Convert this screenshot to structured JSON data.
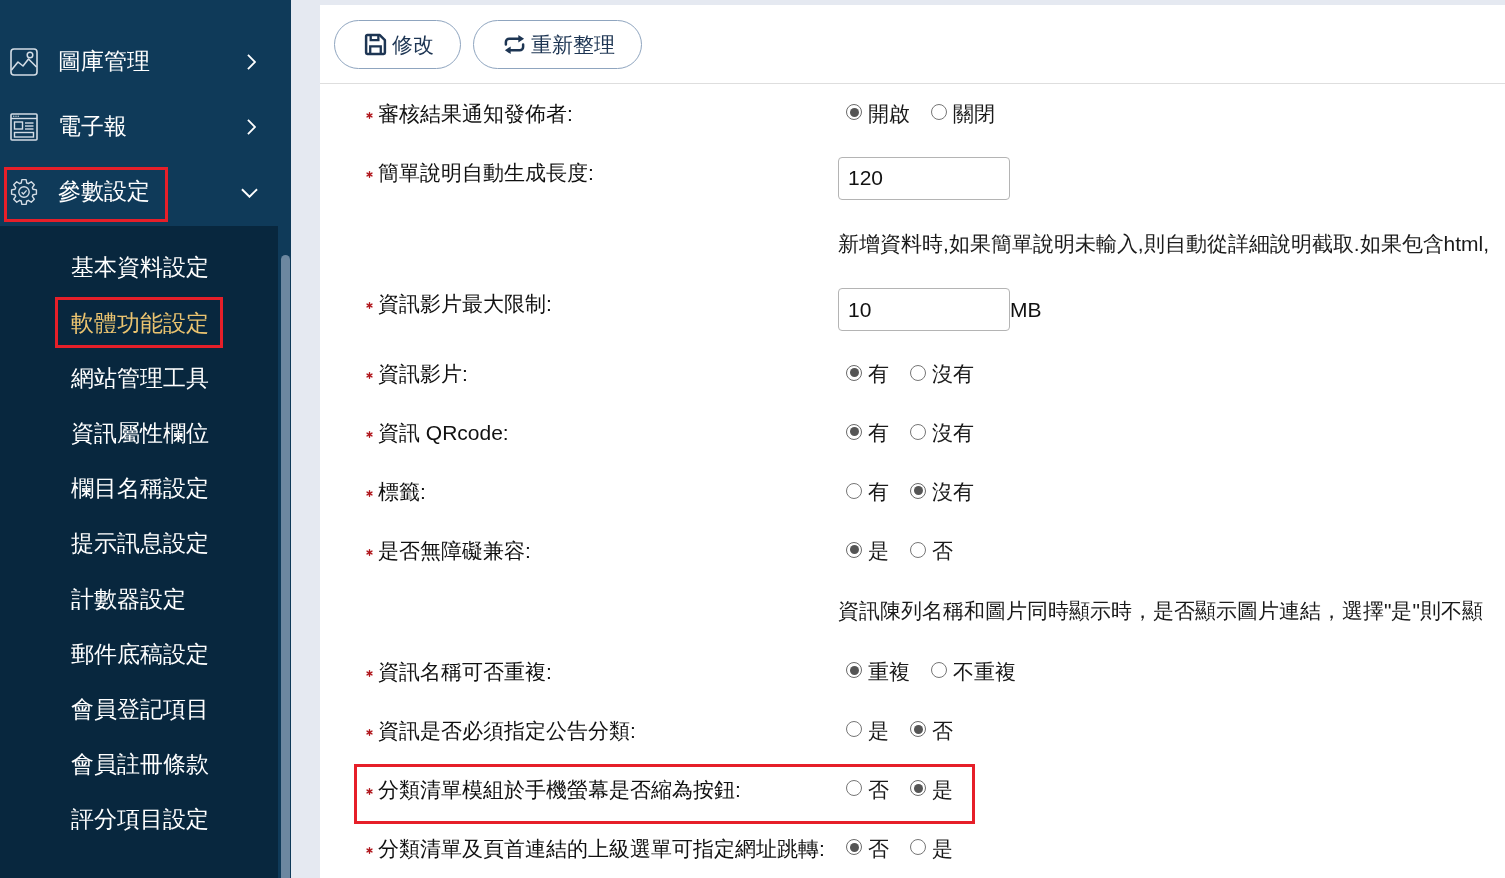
{
  "sidebar": {
    "menu": [
      {
        "label": "圖庫管理",
        "expanded": false,
        "highlighted": false
      },
      {
        "label": "電子報",
        "expanded": false,
        "highlighted": false
      },
      {
        "label": "參數設定",
        "expanded": true,
        "highlighted": true,
        "children": [
          {
            "label": "基本資料設定",
            "selected": false,
            "highlighted": false
          },
          {
            "label": "軟體功能設定",
            "selected": true,
            "highlighted": true
          },
          {
            "label": "網站管理工具",
            "selected": false,
            "highlighted": false
          },
          {
            "label": "資訊屬性欄位",
            "selected": false,
            "highlighted": false
          },
          {
            "label": "欄目名稱設定",
            "selected": false,
            "highlighted": false
          },
          {
            "label": "提示訊息設定",
            "selected": false,
            "highlighted": false
          },
          {
            "label": "計數器設定",
            "selected": false,
            "highlighted": false
          },
          {
            "label": "郵件底稿設定",
            "selected": false,
            "highlighted": false
          },
          {
            "label": "會員登記項目",
            "selected": false,
            "highlighted": false
          },
          {
            "label": "會員註冊條款",
            "selected": false,
            "highlighted": false
          },
          {
            "label": "評分項目設定",
            "selected": false,
            "highlighted": false
          }
        ]
      }
    ]
  },
  "toolbar": {
    "buttons": [
      {
        "label": "修改"
      },
      {
        "label": "重新整理"
      }
    ]
  },
  "form": {
    "rows": [
      {
        "kind": "radio",
        "label": "審核結果通知發佈者:",
        "required": true,
        "highlighted": false,
        "options": [
          {
            "label": "開啟",
            "selected": true
          },
          {
            "label": "關閉",
            "selected": false
          }
        ]
      },
      {
        "kind": "input",
        "label": "簡單說明自動生成長度:",
        "required": true,
        "highlighted": false,
        "value": "120"
      },
      {
        "kind": "note",
        "text": "新增資料時,如果簡單說明未輸入,則自動從詳細說明截取.如果包含html,",
        "highlighted": false
      },
      {
        "kind": "input",
        "label": "資訊影片最大限制:",
        "required": true,
        "highlighted": false,
        "value": "10",
        "unit": "MB"
      },
      {
        "kind": "radio",
        "label": "資訊影片:",
        "required": true,
        "highlighted": false,
        "options": [
          {
            "label": "有",
            "selected": true
          },
          {
            "label": "沒有",
            "selected": false
          }
        ]
      },
      {
        "kind": "radio",
        "label": "資訊 QRcode:",
        "required": true,
        "highlighted": false,
        "options": [
          {
            "label": "有",
            "selected": true
          },
          {
            "label": "沒有",
            "selected": false
          }
        ]
      },
      {
        "kind": "radio",
        "label": "標籤:",
        "required": true,
        "highlighted": false,
        "options": [
          {
            "label": "有",
            "selected": false
          },
          {
            "label": "沒有",
            "selected": true
          }
        ]
      },
      {
        "kind": "radio",
        "label": "是否無障礙兼容:",
        "required": true,
        "highlighted": false,
        "options": [
          {
            "label": "是",
            "selected": true
          },
          {
            "label": "否",
            "selected": false
          }
        ]
      },
      {
        "kind": "note",
        "text": "資訊陳列名稱和圖片同時顯示時，是否顯示圖片連結，選擇\"是\"則不顯",
        "highlighted": false
      },
      {
        "kind": "radio",
        "label": "資訊名稱可否重複:",
        "required": true,
        "highlighted": false,
        "options": [
          {
            "label": "重複",
            "selected": true
          },
          {
            "label": "不重複",
            "selected": false
          }
        ]
      },
      {
        "kind": "radio",
        "label": "資訊是否必須指定公告分類:",
        "required": true,
        "highlighted": false,
        "options": [
          {
            "label": "是",
            "selected": false
          },
          {
            "label": "否",
            "selected": true
          }
        ]
      },
      {
        "kind": "radio",
        "label": "分類清單模組於手機螢幕是否縮為按鈕:",
        "required": true,
        "highlighted": true,
        "options": [
          {
            "label": "否",
            "selected": false
          },
          {
            "label": "是",
            "selected": true
          }
        ]
      },
      {
        "kind": "radio",
        "label": "分類清單及頁首連結的上級選單可指定網址跳轉:",
        "required": true,
        "highlighted": false,
        "options": [
          {
            "label": "否",
            "selected": true
          },
          {
            "label": "是",
            "selected": false
          }
        ]
      }
    ]
  }
}
